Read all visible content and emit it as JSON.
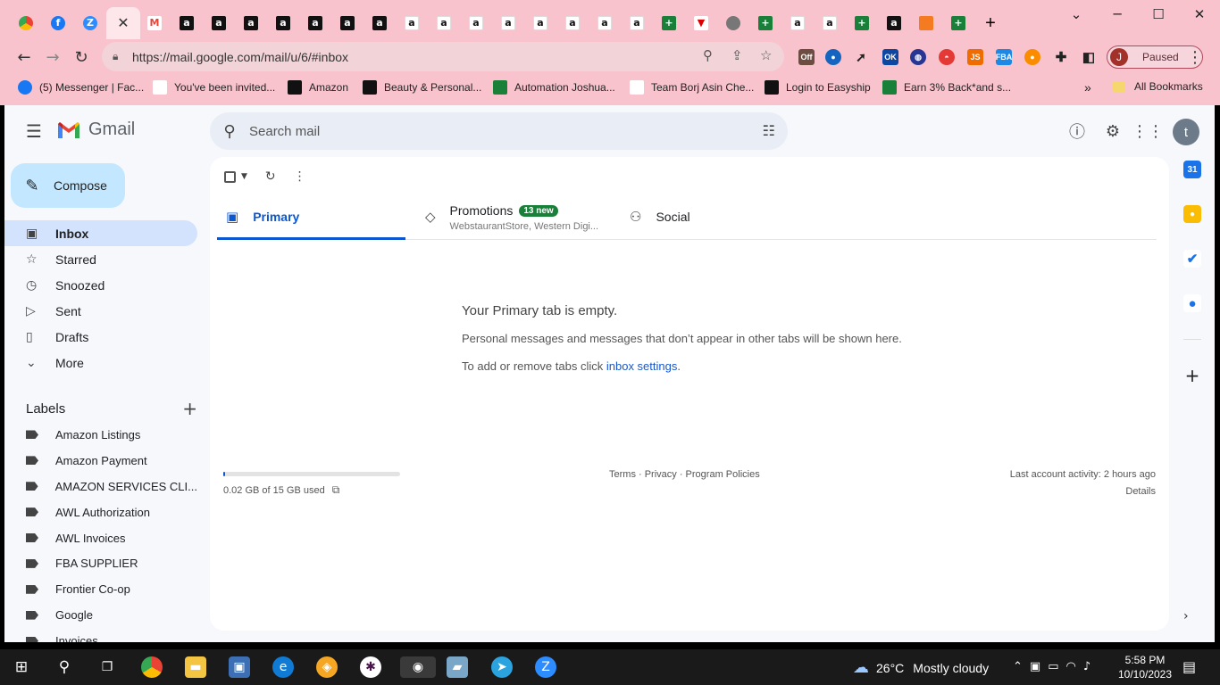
{
  "browser": {
    "tabs": [
      {
        "icon": "chrome",
        "glyph": ""
      },
      {
        "icon": "facebook",
        "glyph": "f"
      },
      {
        "icon": "zoom",
        "glyph": "Z"
      },
      {
        "icon": "close",
        "glyph": "✕"
      },
      {
        "icon": "gmail",
        "glyph": "M"
      },
      {
        "icon": "amazon",
        "glyph": "a"
      },
      {
        "icon": "amazon",
        "glyph": "a"
      },
      {
        "icon": "amazon",
        "glyph": "a"
      },
      {
        "icon": "amazon",
        "glyph": "a"
      },
      {
        "icon": "amazon",
        "glyph": "a"
      },
      {
        "icon": "amazon",
        "glyph": "a"
      },
      {
        "icon": "amazon",
        "glyph": "a"
      },
      {
        "icon": "amazon-light",
        "glyph": "a"
      },
      {
        "icon": "amazon-light",
        "glyph": "a"
      },
      {
        "icon": "amazon-light",
        "glyph": "a"
      },
      {
        "icon": "amazon-light",
        "glyph": "a"
      },
      {
        "icon": "amazon-light",
        "glyph": "a"
      },
      {
        "icon": "amazon-light",
        "glyph": "a"
      },
      {
        "icon": "amazon-light",
        "glyph": "a"
      },
      {
        "icon": "amazon-light",
        "glyph": "a"
      },
      {
        "icon": "sheets",
        "glyph": "+"
      },
      {
        "icon": "v-logo",
        "glyph": "▼"
      },
      {
        "icon": "globe",
        "glyph": ""
      },
      {
        "icon": "sheets",
        "glyph": "+"
      },
      {
        "icon": "amazon-light",
        "glyph": "a"
      },
      {
        "icon": "amazon-light",
        "glyph": "a"
      },
      {
        "icon": "sheets",
        "glyph": "+"
      },
      {
        "icon": "amazon",
        "glyph": "a"
      },
      {
        "icon": "tool",
        "glyph": ""
      },
      {
        "icon": "sheets",
        "glyph": "+"
      }
    ],
    "new_tab": "+",
    "url": "https://mail.google.com/mail/u/6/#inbox",
    "profile_initial": "J",
    "profile_status": "Paused",
    "bookmarks": [
      {
        "label": "(5) Messenger | Fac...",
        "icon": "facebook-icon"
      },
      {
        "label": "You've been invited...",
        "icon": "gmail-icon"
      },
      {
        "label": "Amazon",
        "icon": "amazon-icon"
      },
      {
        "label": "Beauty & Personal...",
        "icon": "amazon-icon"
      },
      {
        "label": "Automation Joshua...",
        "icon": "sheets-icon"
      },
      {
        "label": "Team Borj Asin Che...",
        "icon": "team-icon"
      },
      {
        "label": "Login to Easyship",
        "icon": "easyship-icon"
      },
      {
        "label": "Earn 3% Back*and s...",
        "icon": "earn-icon"
      }
    ],
    "all_bookmarks": "All Bookmarks",
    "bookmarks_more": "»"
  },
  "gmail": {
    "product_name": "Gmail",
    "search_placeholder": "Search mail",
    "account_initial": "t",
    "compose_label": "Compose",
    "nav": [
      {
        "label": "Inbox",
        "icon": "inbox-icon",
        "glyph": "▣"
      },
      {
        "label": "Starred",
        "icon": "star-icon",
        "glyph": "☆"
      },
      {
        "label": "Snoozed",
        "icon": "clock-icon",
        "glyph": "◷"
      },
      {
        "label": "Sent",
        "icon": "send-icon",
        "glyph": "▷"
      },
      {
        "label": "Drafts",
        "icon": "draft-icon",
        "glyph": "▯"
      },
      {
        "label": "More",
        "icon": "chevron-down-icon",
        "glyph": "⌄"
      }
    ],
    "labels_title": "Labels",
    "labels": [
      "Amazon Listings",
      "Amazon Payment",
      "AMAZON SERVICES CLI...",
      "AWL Authorization",
      "AWL Invoices",
      "FBA SUPPLIER",
      "Frontier Co-op",
      "Google",
      "Invoices"
    ],
    "tabs": {
      "primary": "Primary",
      "promotions": "Promotions",
      "promotions_badge": "13 new",
      "promotions_senders": "WebstaurantStore, Western Digi...",
      "social": "Social"
    },
    "empty": {
      "heading": "Your Primary tab is empty.",
      "line1": "Personal messages and messages that don’t appear in other tabs will be shown here.",
      "line2_prefix": "To add or remove tabs click ",
      "line2_link": "inbox settings",
      "line2_suffix": "."
    },
    "footer": {
      "storage": "0.02 GB of 15 GB used",
      "storage_fraction": 0.0013,
      "links": "Terms · Privacy · Program Policies",
      "activity": "Last account activity: 2 hours ago",
      "details": "Details"
    }
  },
  "taskbar": {
    "weather_temp": "26°C",
    "weather_desc": "Mostly cloudy",
    "time": "5:58 PM",
    "date": "10/10/2023"
  }
}
